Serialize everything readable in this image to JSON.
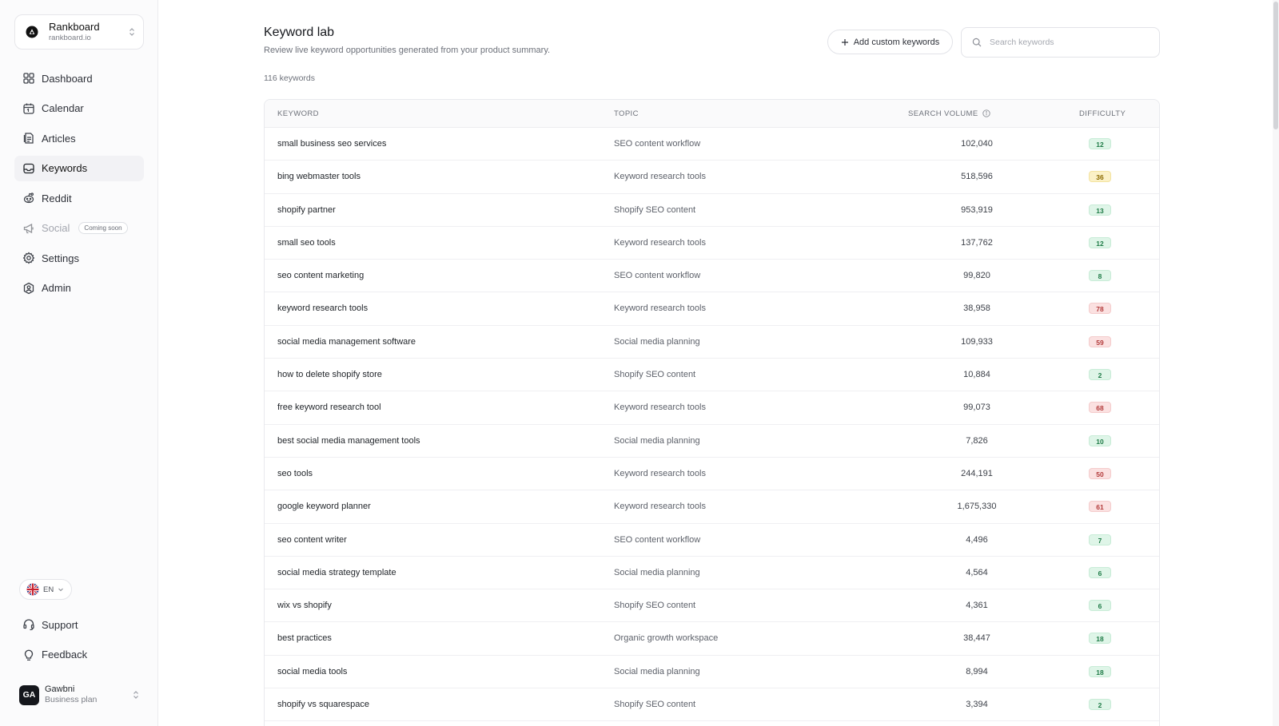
{
  "workspace": {
    "name": "Rankboard",
    "domain": "rankboard.io"
  },
  "nav": [
    {
      "label": "Dashboard",
      "icon": "dashboard-icon",
      "active": false
    },
    {
      "label": "Calendar",
      "icon": "calendar-icon",
      "active": false
    },
    {
      "label": "Articles",
      "icon": "articles-icon",
      "active": false
    },
    {
      "label": "Keywords",
      "icon": "inbox-icon",
      "active": true
    },
    {
      "label": "Reddit",
      "icon": "reddit-icon",
      "active": false
    },
    {
      "label": "Social",
      "icon": "megaphone-icon",
      "active": false,
      "badge": "Coming soon"
    },
    {
      "label": "Settings",
      "icon": "gear-icon",
      "active": false
    },
    {
      "label": "Admin",
      "icon": "admin-icon",
      "active": false
    }
  ],
  "language": {
    "label": "EN",
    "flag": "uk-flag-icon"
  },
  "bottom_nav": [
    {
      "label": "Support",
      "icon": "headset-icon"
    },
    {
      "label": "Feedback",
      "icon": "lightbulb-icon"
    }
  ],
  "user": {
    "initials": "GA",
    "name": "Gawbni",
    "plan": "Business plan"
  },
  "page": {
    "title": "Keyword lab",
    "subtitle": "Review live keyword opportunities generated from your product summary.",
    "count": "116 keywords",
    "add_button": "Add custom keywords",
    "search_placeholder": "Search keywords"
  },
  "table": {
    "headers": {
      "keyword": "KEYWORD",
      "topic": "TOPIC",
      "volume": "SEARCH VOLUME",
      "difficulty": "DIFFICULTY"
    },
    "rows": [
      {
        "keyword": "small business seo services",
        "topic": "SEO content workflow",
        "volume": "102,040",
        "difficulty": "12",
        "level": "green"
      },
      {
        "keyword": "bing webmaster tools",
        "topic": "Keyword research tools",
        "volume": "518,596",
        "difficulty": "36",
        "level": "yellow"
      },
      {
        "keyword": "shopify partner",
        "topic": "Shopify SEO content",
        "volume": "953,919",
        "difficulty": "13",
        "level": "green"
      },
      {
        "keyword": "small seo tools",
        "topic": "Keyword research tools",
        "volume": "137,762",
        "difficulty": "12",
        "level": "green"
      },
      {
        "keyword": "seo content marketing",
        "topic": "SEO content workflow",
        "volume": "99,820",
        "difficulty": "8",
        "level": "green"
      },
      {
        "keyword": "keyword research tools",
        "topic": "Keyword research tools",
        "volume": "38,958",
        "difficulty": "78",
        "level": "red"
      },
      {
        "keyword": "social media management software",
        "topic": "Social media planning",
        "volume": "109,933",
        "difficulty": "59",
        "level": "red"
      },
      {
        "keyword": "how to delete shopify store",
        "topic": "Shopify SEO content",
        "volume": "10,884",
        "difficulty": "2",
        "level": "green"
      },
      {
        "keyword": "free keyword research tool",
        "topic": "Keyword research tools",
        "volume": "99,073",
        "difficulty": "68",
        "level": "red"
      },
      {
        "keyword": "best social media management tools",
        "topic": "Social media planning",
        "volume": "7,826",
        "difficulty": "10",
        "level": "green"
      },
      {
        "keyword": "seo tools",
        "topic": "Keyword research tools",
        "volume": "244,191",
        "difficulty": "50",
        "level": "red"
      },
      {
        "keyword": "google keyword planner",
        "topic": "Keyword research tools",
        "volume": "1,675,330",
        "difficulty": "61",
        "level": "red"
      },
      {
        "keyword": "seo content writer",
        "topic": "SEO content workflow",
        "volume": "4,496",
        "difficulty": "7",
        "level": "green"
      },
      {
        "keyword": "social media strategy template",
        "topic": "Social media planning",
        "volume": "4,564",
        "difficulty": "6",
        "level": "green"
      },
      {
        "keyword": "wix vs shopify",
        "topic": "Shopify SEO content",
        "volume": "4,361",
        "difficulty": "6",
        "level": "green"
      },
      {
        "keyword": "best practices",
        "topic": "Organic growth workspace",
        "volume": "38,447",
        "difficulty": "18",
        "level": "green"
      },
      {
        "keyword": "social media tools",
        "topic": "Social media planning",
        "volume": "8,994",
        "difficulty": "18",
        "level": "green"
      },
      {
        "keyword": "shopify vs squarespace",
        "topic": "Shopify SEO content",
        "volume": "3,394",
        "difficulty": "2",
        "level": "green"
      }
    ]
  }
}
